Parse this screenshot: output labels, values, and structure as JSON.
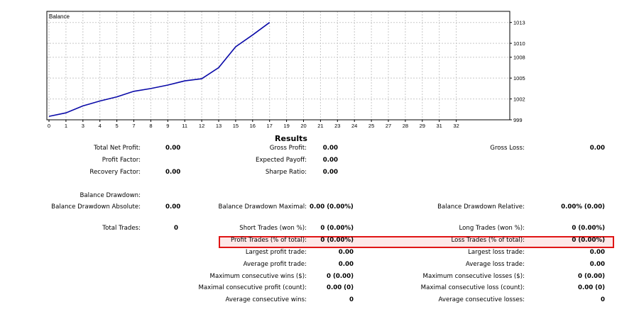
{
  "chart_data": {
    "type": "line",
    "title": "Balance",
    "x": [
      0,
      1,
      3,
      4,
      5,
      7,
      8,
      9,
      11,
      12,
      13,
      15,
      16,
      17
    ],
    "y": [
      999.5,
      1000.0,
      1001.0,
      1001.7,
      1002.3,
      1003.1,
      1003.5,
      1004.0,
      1004.6,
      1004.9,
      1006.5,
      1009.5,
      1011.2,
      1013.0
    ],
    "x_ticks": [
      "0",
      "1",
      "3",
      "4",
      "5",
      "7",
      "8",
      "9",
      "11",
      "12",
      "13",
      "15",
      "16",
      "17",
      "19",
      "20",
      "21",
      "23",
      "24",
      "25",
      "27",
      "28",
      "29",
      "31",
      "32"
    ],
    "y_ticks": [
      "1013",
      "1010",
      "1008",
      "1005",
      "1002",
      "999"
    ],
    "line_color": "#0a0aa8",
    "grid": true
  },
  "results": {
    "title": "Results",
    "rows": [
      {
        "name": "total-net-profit",
        "label": "Total Net Profit:",
        "value": "0.00"
      },
      {
        "name": "gross-profit",
        "label": "Gross Profit:",
        "value": "0.00"
      },
      {
        "name": "gross-loss",
        "label": "Gross Loss:",
        "value": "0.00"
      },
      {
        "name": "profit-factor",
        "label": "Profit Factor:",
        "value": ""
      },
      {
        "name": "expected-payoff",
        "label": "Expected Payoff:",
        "value": "0.00"
      },
      {
        "name": "recovery-factor",
        "label": "Recovery Factor:",
        "value": "0.00"
      },
      {
        "name": "sharpe-ratio",
        "label": "Sharpe Ratio:",
        "value": "0.00"
      },
      {
        "name": "balance-drawdown",
        "label": "Balance Drawdown:",
        "value": ""
      },
      {
        "name": "balance-drawdown-absolute",
        "label": "Balance Drawdown Absolute:",
        "value": "0.00"
      },
      {
        "name": "balance-drawdown-maximal",
        "label": "Balance Drawdown Maximal:",
        "value": "0.00 (0.00%)"
      },
      {
        "name": "balance-drawdown-relative",
        "label": "Balance Drawdown Relative:",
        "value": "0.00% (0.00)"
      },
      {
        "name": "total-trades",
        "label": "Total Trades:",
        "value": "0"
      },
      {
        "name": "short-trades",
        "label": "Short Trades (won %):",
        "value": "0 (0.00%)"
      },
      {
        "name": "long-trades",
        "label": "Long Trades (won %):",
        "value": "0 (0.00%)"
      },
      {
        "name": "profit-trades",
        "label": "Profit Trades (% of total):",
        "value": "0 (0.00%)"
      },
      {
        "name": "loss-trades",
        "label": "Loss Trades (% of total):",
        "value": "0 (0.00%)"
      },
      {
        "name": "largest-profit-trade",
        "label": "Largest profit trade:",
        "value": "0.00"
      },
      {
        "name": "largest-loss-trade",
        "label": "Largest loss trade:",
        "value": "0.00"
      },
      {
        "name": "average-profit-trade",
        "label": "Average profit trade:",
        "value": "0.00"
      },
      {
        "name": "average-loss-trade",
        "label": "Average loss trade:",
        "value": "0.00"
      },
      {
        "name": "max-consecutive-wins",
        "label": "Maximum consecutive wins ($):",
        "value": "0 (0.00)"
      },
      {
        "name": "max-consecutive-losses",
        "label": "Maximum consecutive losses ($):",
        "value": "0 (0.00)"
      },
      {
        "name": "maximal-consecutive-profit",
        "label": "Maximal consecutive profit (count):",
        "value": "0.00 (0)"
      },
      {
        "name": "maximal-consecutive-loss",
        "label": "Maximal consecutive loss (count):",
        "value": "0.00 (0)"
      },
      {
        "name": "average-consecutive-wins",
        "label": "Average consecutive wins:",
        "value": "0"
      },
      {
        "name": "average-consecutive-losses",
        "label": "Average consecutive losses:",
        "value": "0"
      }
    ]
  },
  "highlight_color": "#e01515"
}
